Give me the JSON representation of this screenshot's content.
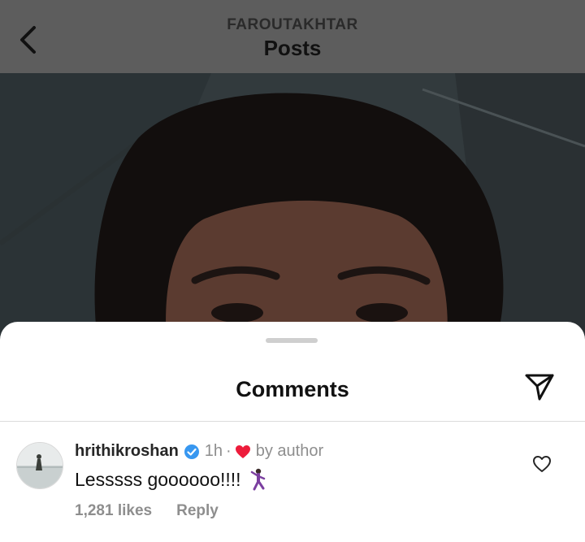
{
  "header": {
    "owner": "FAROUTAKHTAR",
    "title": "Posts",
    "back_icon": "chevron-left-icon"
  },
  "sheet": {
    "title": "Comments",
    "share_icon": "send-icon"
  },
  "comment": {
    "username": "hrithikroshan",
    "verified": true,
    "time": "1h",
    "separator": "·",
    "liked_by_author": "by author",
    "text": "Lesssss goooooo!!!!",
    "emoji": "person-dancing-emoji",
    "likes": "1,281 likes",
    "reply_label": "Reply",
    "like_icon": "heart-outline-icon"
  },
  "colors": {
    "verified_badge": "#3797f0",
    "author_heart": "#ed1c3b",
    "secondary_text": "#8e8e8e"
  }
}
